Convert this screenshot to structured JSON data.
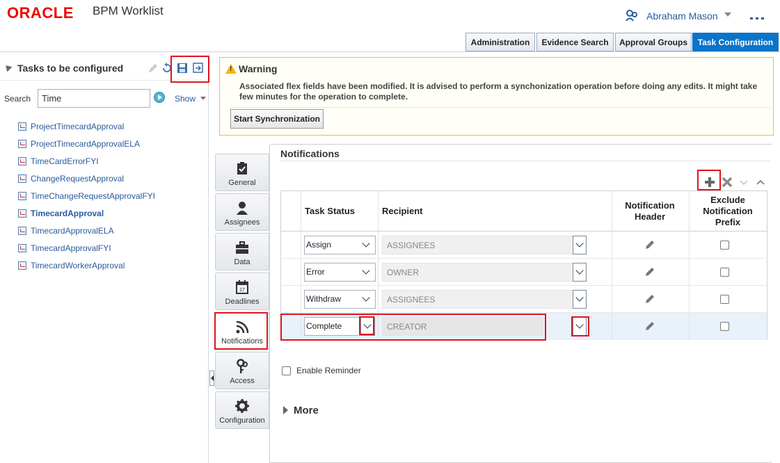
{
  "header": {
    "brand": "ORACLE",
    "app_title": "BPM Worklist",
    "user_name": "Abraham Mason"
  },
  "top_tabs": [
    {
      "label": "Administration",
      "active": false
    },
    {
      "label": "Evidence Search",
      "active": false
    },
    {
      "label": "Approval Groups",
      "active": false
    },
    {
      "label": "Task Configuration",
      "active": true
    }
  ],
  "left_panel": {
    "title": "Tasks to be configured",
    "search_label": "Search",
    "search_value": "Time",
    "show_label": "Show",
    "tasks": [
      {
        "label": "ProjectTimecardApproval",
        "selected": false
      },
      {
        "label": "ProjectTimecardApprovalELA",
        "selected": false
      },
      {
        "label": "TimeCardErrorFYI",
        "selected": false
      },
      {
        "label": "ChangeRequestApproval",
        "selected": false
      },
      {
        "label": "TimeChangeRequestApprovalFYI",
        "selected": false
      },
      {
        "label": "TimecardApproval",
        "selected": true
      },
      {
        "label": "TimecardApprovalELA",
        "selected": false
      },
      {
        "label": "TimecardApprovalFYI",
        "selected": false
      },
      {
        "label": "TimecardWorkerApproval",
        "selected": false
      }
    ]
  },
  "warning": {
    "title": "Warning",
    "message": "Associated flex fields have been modified. It is advised to perform a synchonization operation before doing any edits. It might take few minutes for the operation to complete.",
    "button_label": "Start Synchronization"
  },
  "vertical_tabs": [
    {
      "label": "General",
      "icon": "clipboard-check-icon"
    },
    {
      "label": "Assignees",
      "icon": "person-icon"
    },
    {
      "label": "Data",
      "icon": "briefcase-icon"
    },
    {
      "label": "Deadlines",
      "icon": "calendar-icon"
    },
    {
      "label": "Notifications",
      "icon": "rss-icon",
      "active": true
    },
    {
      "label": "Access",
      "icon": "keys-icon"
    },
    {
      "label": "Configuration",
      "icon": "gear-icon"
    }
  ],
  "notifications": {
    "title": "Notifications",
    "columns": {
      "task_status": "Task Status",
      "recipient": "Recipient",
      "notification_header": "Notification Header",
      "exclude_prefix": "Exclude Notification Prefix"
    },
    "rows": [
      {
        "status": "Assign",
        "recipient": "ASSIGNEES",
        "exclude": false
      },
      {
        "status": "Error",
        "recipient": "OWNER",
        "exclude": false
      },
      {
        "status": "Withdraw",
        "recipient": "ASSIGNEES",
        "exclude": false
      },
      {
        "status": "Complete",
        "recipient": "CREATOR",
        "exclude": false,
        "selected": true
      }
    ],
    "enable_reminder_label": "Enable Reminder",
    "enable_reminder": false,
    "more_label": "More",
    "colors": {
      "highlight": "#e0141e",
      "active_tab": "#0a74c9",
      "link": "#2a5a9b"
    }
  }
}
